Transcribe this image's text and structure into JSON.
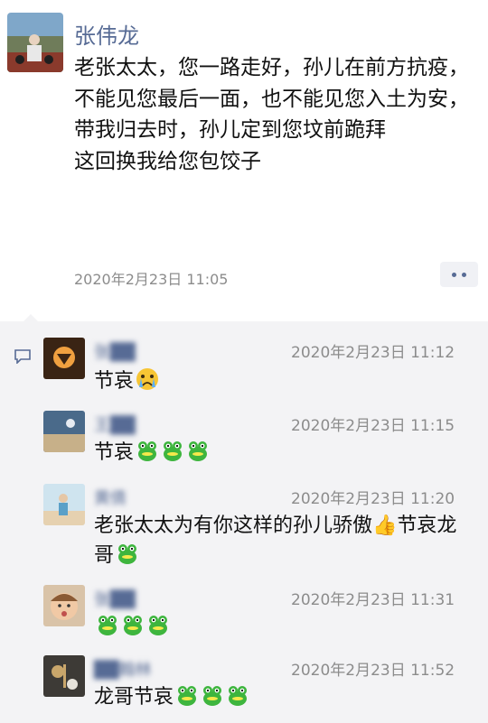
{
  "post": {
    "author": "张伟龙",
    "text": "老张太太，您一路走好，孙儿在前方抗疫，\n不能见您最后一面，也不能见您入土为安，\n带我归去时，孙儿定到您坟前跪拜\n这回换我给您包饺子",
    "timestamp": "2020年2月23日 11:05"
  },
  "comments": [
    {
      "name": "张██",
      "time": "2020年2月23日 11:12",
      "text": "节哀",
      "emojis": [
        "crying-face-emoji"
      ]
    },
    {
      "name": "王██",
      "time": "2020年2月23日 11:15",
      "text": "节哀",
      "emojis": [
        "frog-emoji",
        "frog-emoji",
        "frog-emoji"
      ]
    },
    {
      "name": "黄倩",
      "time": "2020年2月23日 11:20",
      "text": "老张太太为有你这样的孙儿骄傲👍节哀龙哥",
      "emojis": [
        "frog-emoji"
      ]
    },
    {
      "name": "张██",
      "time": "2020年2月23日 11:31",
      "text": "",
      "emojis": [
        "frog-emoji",
        "frog-emoji",
        "frog-emoji"
      ]
    },
    {
      "name": "██翰林",
      "time": "2020年2月23日 11:52",
      "text": "龙哥节哀",
      "emojis": [
        "frog-emoji",
        "frog-emoji",
        "frog-emoji"
      ]
    }
  ],
  "colors": {
    "name": "#576b95",
    "panel": "#f3f3f5",
    "text": "#111111",
    "time": "#8c8c8c"
  }
}
